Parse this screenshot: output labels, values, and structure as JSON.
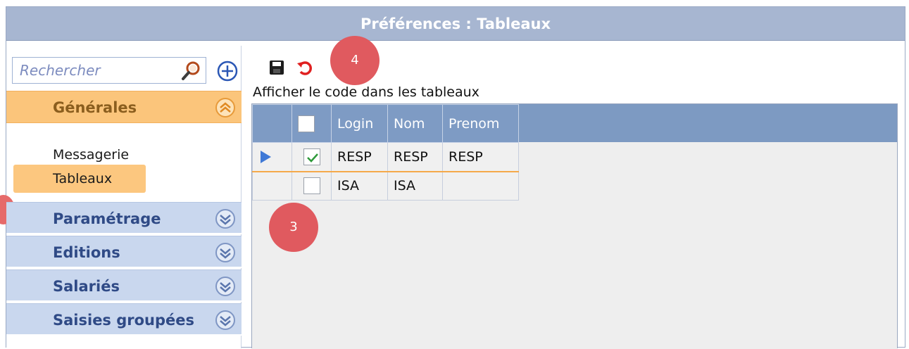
{
  "window": {
    "title": "Préférences : Tableaux"
  },
  "sidebar": {
    "search": {
      "placeholder": "Rechercher",
      "value": ""
    },
    "sections": [
      {
        "label": "Générales",
        "state": "expanded",
        "items": [
          {
            "label": "Messagerie",
            "selected": false
          },
          {
            "label": "Tableaux",
            "selected": true
          }
        ]
      },
      {
        "label": "Paramétrage",
        "state": "collapsed"
      },
      {
        "label": "Editions",
        "state": "collapsed"
      },
      {
        "label": "Salariés",
        "state": "collapsed"
      },
      {
        "label": "Saisies groupées",
        "state": "collapsed"
      }
    ]
  },
  "main": {
    "toolbar": {
      "icons": [
        "save-icon",
        "undo-icon"
      ]
    },
    "section_title": "Afficher le code dans les tableaux",
    "grid": {
      "columns": [
        "Login",
        "Nom",
        "Prenom"
      ],
      "rows": [
        {
          "checked": true,
          "current": true,
          "cells": [
            "RESP",
            "RESP",
            "RESP"
          ]
        },
        {
          "checked": false,
          "current": false,
          "cells": [
            "ISA",
            "ISA",
            ""
          ]
        }
      ]
    }
  },
  "annotations": [
    {
      "label": "4"
    },
    {
      "label": "3"
    }
  ],
  "colors": {
    "titlebar": "#a7b6d1",
    "active_section": "#fbc57b",
    "collapsed_section": "#c9d7ee",
    "grid_header": "#7e9bc4",
    "badge": "#e05a5f"
  }
}
